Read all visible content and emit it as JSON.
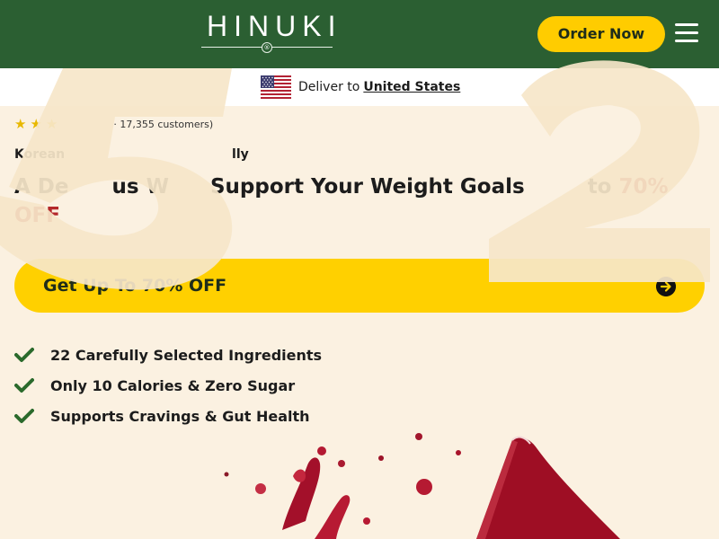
{
  "header": {
    "logo": "HINUKI",
    "logo_mark": "®",
    "order_label": "Order Now",
    "menu_icon": "hamburger-menu-icon"
  },
  "deliver": {
    "prefix": "Deliver to",
    "country": "United States",
    "flag_icon": "us-flag-icon"
  },
  "rating": {
    "stars": 3,
    "text": "· 17,355 customers)"
  },
  "hero": {
    "subtitle_start": "Korean",
    "subtitle_end": "lly",
    "headline_a": "A De",
    "headline_b": "us W",
    "headline_c": "Support Your Weight Goals",
    "headline_d": "to",
    "headline_accent": "70%",
    "headline_accent2": "OFF"
  },
  "cta": {
    "label": "Get Up To 70% OFF",
    "arrow_icon": "arrow-right-circle-icon"
  },
  "benefits": [
    {
      "label": "22 Carefully Selected Ingredients"
    },
    {
      "label": "Only 10 Calories & Zero Sugar"
    },
    {
      "label": "Supports Cravings & Gut Health"
    }
  ],
  "colors": {
    "header_bg": "#2b5f32",
    "accent_yellow": "#ffcc00",
    "accent_red": "#b4282a",
    "page_bg": "#fbf1e1",
    "check_green": "#2b6a2c"
  }
}
